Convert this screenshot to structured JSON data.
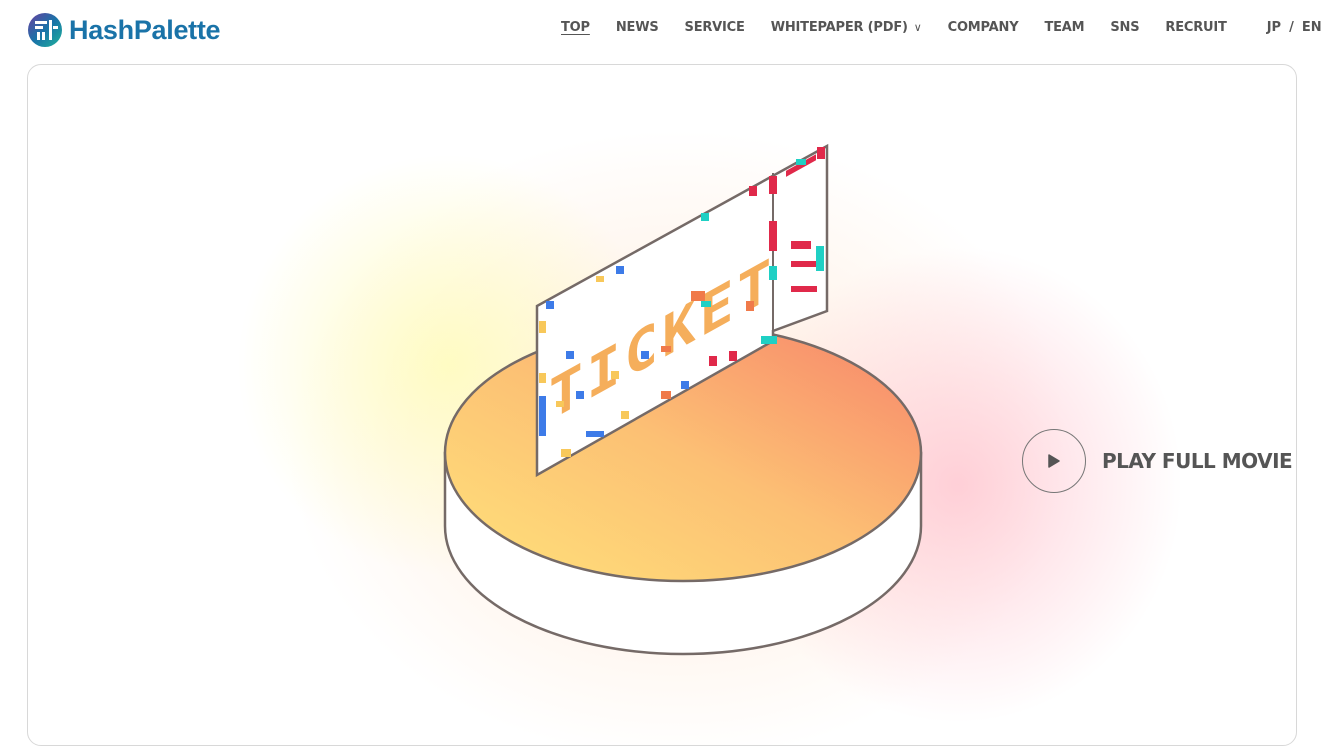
{
  "brand": {
    "name": "HashPalette",
    "color": "#1a73a8"
  },
  "nav": {
    "items": [
      {
        "label": "TOP",
        "active": true
      },
      {
        "label": "NEWS"
      },
      {
        "label": "SERVICE"
      },
      {
        "label": "WHITEPAPER (PDF)",
        "has_dropdown": true,
        "caret": "∨"
      },
      {
        "label": "COMPANY"
      },
      {
        "label": "TEAM"
      },
      {
        "label": "SNS"
      },
      {
        "label": "RECRUIT"
      }
    ],
    "lang": {
      "jp": "JP",
      "sep": "/",
      "en": "EN"
    }
  },
  "hero": {
    "ticket_text": "TICKET",
    "play_label": "PLAY FULL MOVIE",
    "play_icon": "play-icon"
  }
}
